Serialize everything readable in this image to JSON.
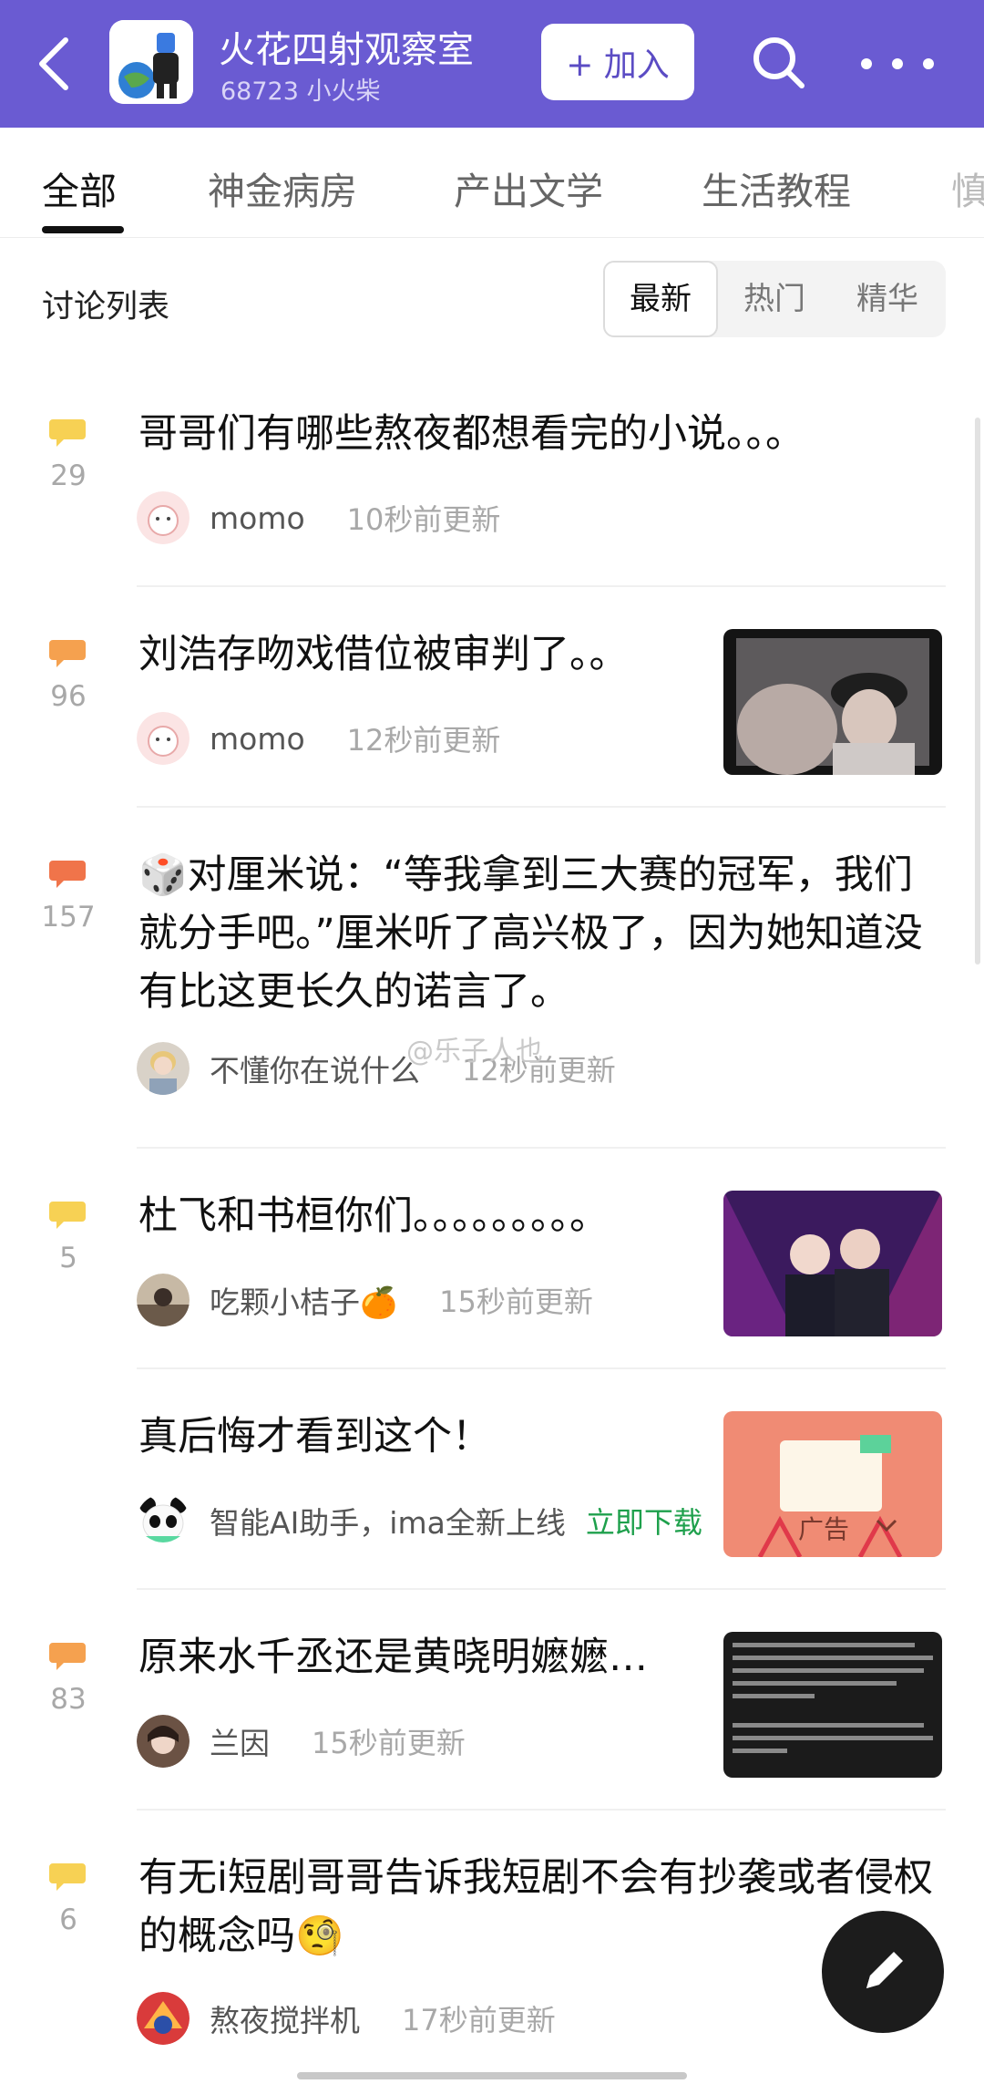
{
  "header": {
    "title": "火花四射观察室",
    "subtitle": "68723 小火柴",
    "join_label": "+ 加入",
    "icons": [
      "back-arrow-icon",
      "search-icon",
      "more-icon"
    ],
    "color": "#6a5bd2"
  },
  "tabs": [
    {
      "label": "全部",
      "active": true
    },
    {
      "label": "神金病房"
    },
    {
      "label": "产出文学"
    },
    {
      "label": "生活教程"
    },
    {
      "label": "慎"
    }
  ],
  "list": {
    "title": "讨论列表",
    "sort_options": [
      "最新",
      "热门",
      "精华"
    ],
    "selected_sort": "最新"
  },
  "posts": [
    {
      "title": "哥哥们有哪些熬夜都想看完的小说。。。",
      "count": "29",
      "author": "momo",
      "time": "10秒前更新"
    },
    {
      "title": "刘浩存吻戏借位被审判了。。",
      "count": "96",
      "author": "momo",
      "time": "12秒前更新",
      "has_thumbnail": true
    },
    {
      "title": "🎲对厘米说：“等我拿到三大赛的冠军，我们就分手吧。”厘米听了高兴极了，因为她知道没有比这更长久的诺言了。",
      "count": "157",
      "author": "不懂你在说什么",
      "time": "12秒前更新"
    },
    {
      "title": "杜飞和书桓你们。。。。。。。。。",
      "count": "5",
      "author": "吃颗小桔子🍊",
      "time": "15秒前更新",
      "has_thumbnail": true
    },
    {
      "title": "真后悔才看到这个！",
      "author": "智能AI助手，ima全新上线",
      "action": "立即下载",
      "ad_label": "广告",
      "is_ad": true
    },
    {
      "title": "原来水千丞还是黄晓明嬷嬷…",
      "count": "83",
      "author": "兰因",
      "time": "15秒前更新",
      "has_thumbnail": true
    },
    {
      "title": "有无i短剧哥哥告诉我短剧不会有抄袭或者侵权的概念吗🧐",
      "count": "6",
      "author": "熬夜搅拌机",
      "time": "17秒前更新"
    }
  ],
  "watermark": "@乐子人也",
  "colors": {
    "bubble_yellow": "#f7d154",
    "bubble_orange": "#f5a14f",
    "bubble_red": "#f0744a",
    "download_green": "#1ea04c"
  }
}
